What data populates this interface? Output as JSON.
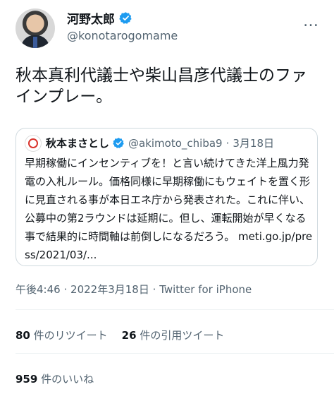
{
  "author": {
    "name": "河野太郎",
    "handle": "@konotarogomame"
  },
  "more_icon": "…",
  "tweet_text": "秋本真利代議士や柴山昌彦代議士のファインプレー。",
  "quote": {
    "name": "秋本まさとし",
    "handle": "@akimoto_chiba9",
    "separator": "·",
    "date": "3月18日",
    "text": "早期稼働にインセンティブを！と言い続けてきた洋上風力発電の入札ルール。価格同様に早期稼働にもウェイトを置く形に見直される事が本日エネ庁から発表された。これに伴い、公募中の第2ラウンドは延期に。但し、運転開始が早くなる事で結果的に時間軸は前倒しになるだろう。 meti.go.jp/press/2021/03/..."
  },
  "meta": {
    "time": "午後4:46",
    "separator": "·",
    "date": "2022年3月18日",
    "separator2": "·",
    "source": "Twitter for iPhone"
  },
  "stats": {
    "retweets_count": "80",
    "retweets_label": "件のリツイート",
    "quotes_count": "26",
    "quotes_label": "件の引用ツイート",
    "likes_count": "959",
    "likes_label": "件のいいね"
  },
  "colors": {
    "verified": "#1d9bf0",
    "secondary_text": "#536471",
    "border": "#cfd9de"
  }
}
